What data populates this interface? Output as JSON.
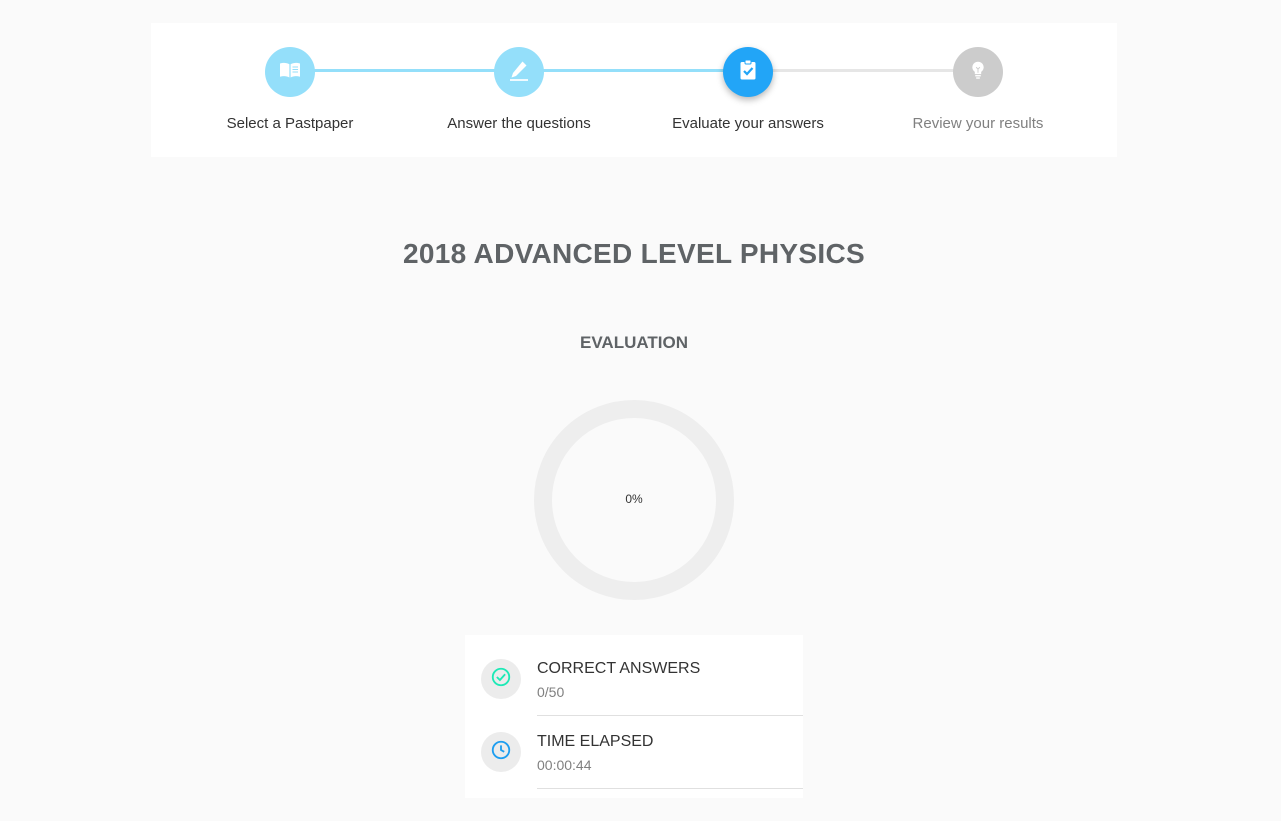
{
  "stepper": {
    "steps": [
      {
        "label": "Select a Pastpaper",
        "icon": "book-icon",
        "color": "#94dffa",
        "state": "completed"
      },
      {
        "label": "Answer the questions",
        "icon": "pencil-icon",
        "color": "#94dffa",
        "state": "completed"
      },
      {
        "label": "Evaluate your answers",
        "icon": "clipboard-check-icon",
        "color": "#22a5f7",
        "state": "active"
      },
      {
        "label": "Review your results",
        "icon": "lightbulb-icon",
        "color": "#cccccc",
        "state": "pending"
      }
    ],
    "connector_done_color": "#94dffa",
    "connector_pending_color": "#e6e6e6"
  },
  "main": {
    "title": "2018 ADVANCED LEVEL PHYSICS",
    "section_title": "EVALUATION",
    "progress": {
      "text": "0%",
      "value": 0,
      "track_color": "#eeeeee"
    }
  },
  "stats": [
    {
      "label": "CORRECT ANSWERS",
      "value": "0/50",
      "icon": "check-circle-icon",
      "icon_color": "#1de9b6"
    },
    {
      "label": "TIME ELAPSED",
      "value": "00:00:44",
      "icon": "clock-icon",
      "icon_color": "#1e9ef0"
    }
  ]
}
